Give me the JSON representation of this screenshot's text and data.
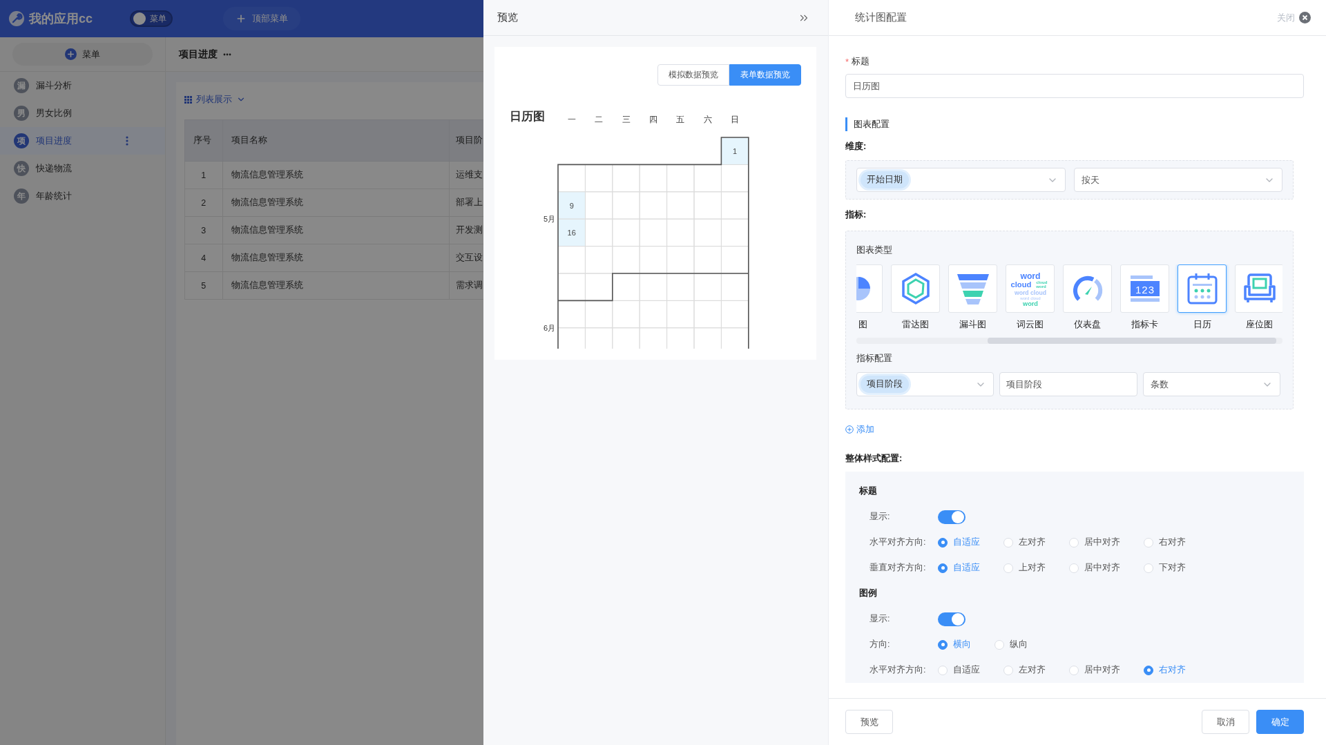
{
  "app": {
    "title": "我的应用cc",
    "menu_toggle": {
      "label": "菜单",
      "on": false
    },
    "top_menu_button": "顶部菜单",
    "sidebar": {
      "add_button": "菜单",
      "items": [
        {
          "avatar": "漏",
          "label": "漏斗分析",
          "selected": false
        },
        {
          "avatar": "男",
          "label": "男女比例",
          "selected": false
        },
        {
          "avatar": "项",
          "label": "项目进度",
          "selected": true
        },
        {
          "avatar": "快",
          "label": "快递物流",
          "selected": false
        },
        {
          "avatar": "年",
          "label": "年龄统计",
          "selected": false
        }
      ]
    },
    "page": {
      "title": "项目进度",
      "view_switch": "列表展示",
      "table": {
        "columns": [
          "序号",
          "项目名称",
          "项目阶"
        ],
        "rows": [
          [
            "1",
            "物流信息管理系统",
            "运维支"
          ],
          [
            "2",
            "物流信息管理系统",
            "部署上"
          ],
          [
            "3",
            "物流信息管理系统",
            "开发测"
          ],
          [
            "4",
            "物流信息管理系统",
            "交互设"
          ],
          [
            "5",
            "物流信息管理系统",
            "需求调"
          ]
        ]
      }
    }
  },
  "preview": {
    "title": "预览",
    "data_tabs": [
      {
        "label": "模拟数据预览",
        "selected": false
      },
      {
        "label": "表单数据预览",
        "selected": true
      }
    ],
    "calendar": {
      "title": "日历图",
      "weekdays": [
        "一",
        "二",
        "三",
        "四",
        "五",
        "六",
        "日"
      ],
      "months": [
        {
          "label": "5月"
        },
        {
          "label": "6月"
        }
      ],
      "weeks": [
        [
          {
            "kind": "blank"
          },
          {
            "kind": "blank"
          },
          {
            "kind": "blank"
          },
          {
            "kind": "blank"
          },
          {
            "kind": "blank"
          },
          {
            "kind": "blank"
          },
          {
            "kind": "first",
            "day": "1",
            "highlighted": true
          }
        ],
        [
          {
            "kind": "first"
          },
          {
            "kind": "first"
          },
          {
            "kind": "first"
          },
          {
            "kind": "first"
          },
          {
            "kind": "first"
          },
          {
            "kind": "first"
          },
          {
            "kind": "first"
          }
        ],
        [
          {
            "kind": "first",
            "day": "9",
            "highlighted": true
          },
          {
            "kind": "first"
          },
          {
            "kind": "first"
          },
          {
            "kind": "first"
          },
          {
            "kind": "first"
          },
          {
            "kind": "first"
          },
          {
            "kind": "first"
          }
        ],
        [
          {
            "kind": "first",
            "day": "16",
            "highlighted": true
          },
          {
            "kind": "first"
          },
          {
            "kind": "first"
          },
          {
            "kind": "first"
          },
          {
            "kind": "first"
          },
          {
            "kind": "first"
          },
          {
            "kind": "first"
          }
        ],
        [
          {
            "kind": "first"
          },
          {
            "kind": "first"
          },
          {
            "kind": "first"
          },
          {
            "kind": "first"
          },
          {
            "kind": "first"
          },
          {
            "kind": "first"
          },
          {
            "kind": "first"
          }
        ],
        [
          {
            "kind": "first"
          },
          {
            "kind": "first"
          },
          {
            "kind": "second"
          },
          {
            "kind": "second"
          },
          {
            "kind": "second"
          },
          {
            "kind": "second"
          },
          {
            "kind": "second"
          }
        ],
        [
          {
            "kind": "second"
          },
          {
            "kind": "second"
          },
          {
            "kind": "second"
          },
          {
            "kind": "second"
          },
          {
            "kind": "second"
          },
          {
            "kind": "second"
          },
          {
            "kind": "second"
          }
        ],
        [
          {
            "kind": "second"
          },
          {
            "kind": "second"
          },
          {
            "kind": "second"
          },
          {
            "kind": "second"
          },
          {
            "kind": "second"
          },
          {
            "kind": "second"
          },
          {
            "kind": "second"
          }
        ]
      ]
    }
  },
  "config": {
    "title": "统计图配置",
    "close": "关闭",
    "title_field": {
      "label": "标题",
      "required_mark": "*",
      "value": "日历图"
    },
    "section_title": "图表配置",
    "dimension": {
      "label": "维度:",
      "field_tag": "开始日期",
      "granularity": "按天"
    },
    "metrics": {
      "label": "指标:",
      "chart_type_label": "图表类型",
      "chart_types": [
        {
          "kind": "pie",
          "label": "图",
          "selected": false
        },
        {
          "kind": "radar",
          "label": "雷达图",
          "selected": false
        },
        {
          "kind": "funnel",
          "label": "漏斗图",
          "selected": false
        },
        {
          "kind": "wordcloud",
          "label": "词云图",
          "selected": false,
          "icon_words": [
            "word",
            "cloud",
            "cloud",
            "word",
            "word cloud",
            "word cloud",
            "word"
          ]
        },
        {
          "kind": "gauge",
          "label": "仪表盘",
          "selected": false
        },
        {
          "kind": "card",
          "label": "指标卡",
          "selected": false,
          "icon_text": "123"
        },
        {
          "kind": "calendar",
          "label": "日历",
          "selected": true
        },
        {
          "kind": "seat",
          "label": "座位图",
          "selected": false
        }
      ],
      "metric_config_label": "指标配置",
      "metric_row": {
        "field_tag": "项目阶段",
        "alias": "项目阶段",
        "aggregate": "条数"
      },
      "add": "添加"
    },
    "style": {
      "title": "整体样式配置:",
      "sections": [
        {
          "title": "标题",
          "rows": [
            {
              "kind": "switch",
              "label": "显示:",
              "on": true
            },
            {
              "kind": "radio",
              "label": "水平对齐方向:",
              "options": [
                {
                  "label": "自适应",
                  "selected": true
                },
                {
                  "label": "左对齐",
                  "selected": false
                },
                {
                  "label": "居中对齐",
                  "selected": false
                },
                {
                  "label": "右对齐",
                  "selected": false
                }
              ]
            },
            {
              "kind": "radio",
              "label": "垂直对齐方向:",
              "options": [
                {
                  "label": "自适应",
                  "selected": true
                },
                {
                  "label": "上对齐",
                  "selected": false
                },
                {
                  "label": "居中对齐",
                  "selected": false
                },
                {
                  "label": "下对齐",
                  "selected": false
                }
              ]
            }
          ]
        },
        {
          "title": "图例",
          "rows": [
            {
              "kind": "switch",
              "label": "显示:",
              "on": true
            },
            {
              "kind": "radio",
              "label": "方向:",
              "options": [
                {
                  "label": "横向",
                  "selected": true
                },
                {
                  "label": "纵向",
                  "selected": false
                }
              ]
            },
            {
              "kind": "radio",
              "label": "水平对齐方向:",
              "options": [
                {
                  "label": "自适应",
                  "selected": false
                },
                {
                  "label": "左对齐",
                  "selected": false
                },
                {
                  "label": "居中对齐",
                  "selected": false
                },
                {
                  "label": "右对齐",
                  "selected": true
                }
              ]
            }
          ]
        }
      ]
    },
    "footer": {
      "left": [
        {
          "label": "预览",
          "kind": "default"
        }
      ],
      "right": [
        {
          "label": "取消",
          "kind": "default"
        },
        {
          "label": "确定",
          "kind": "primary"
        }
      ]
    }
  }
}
